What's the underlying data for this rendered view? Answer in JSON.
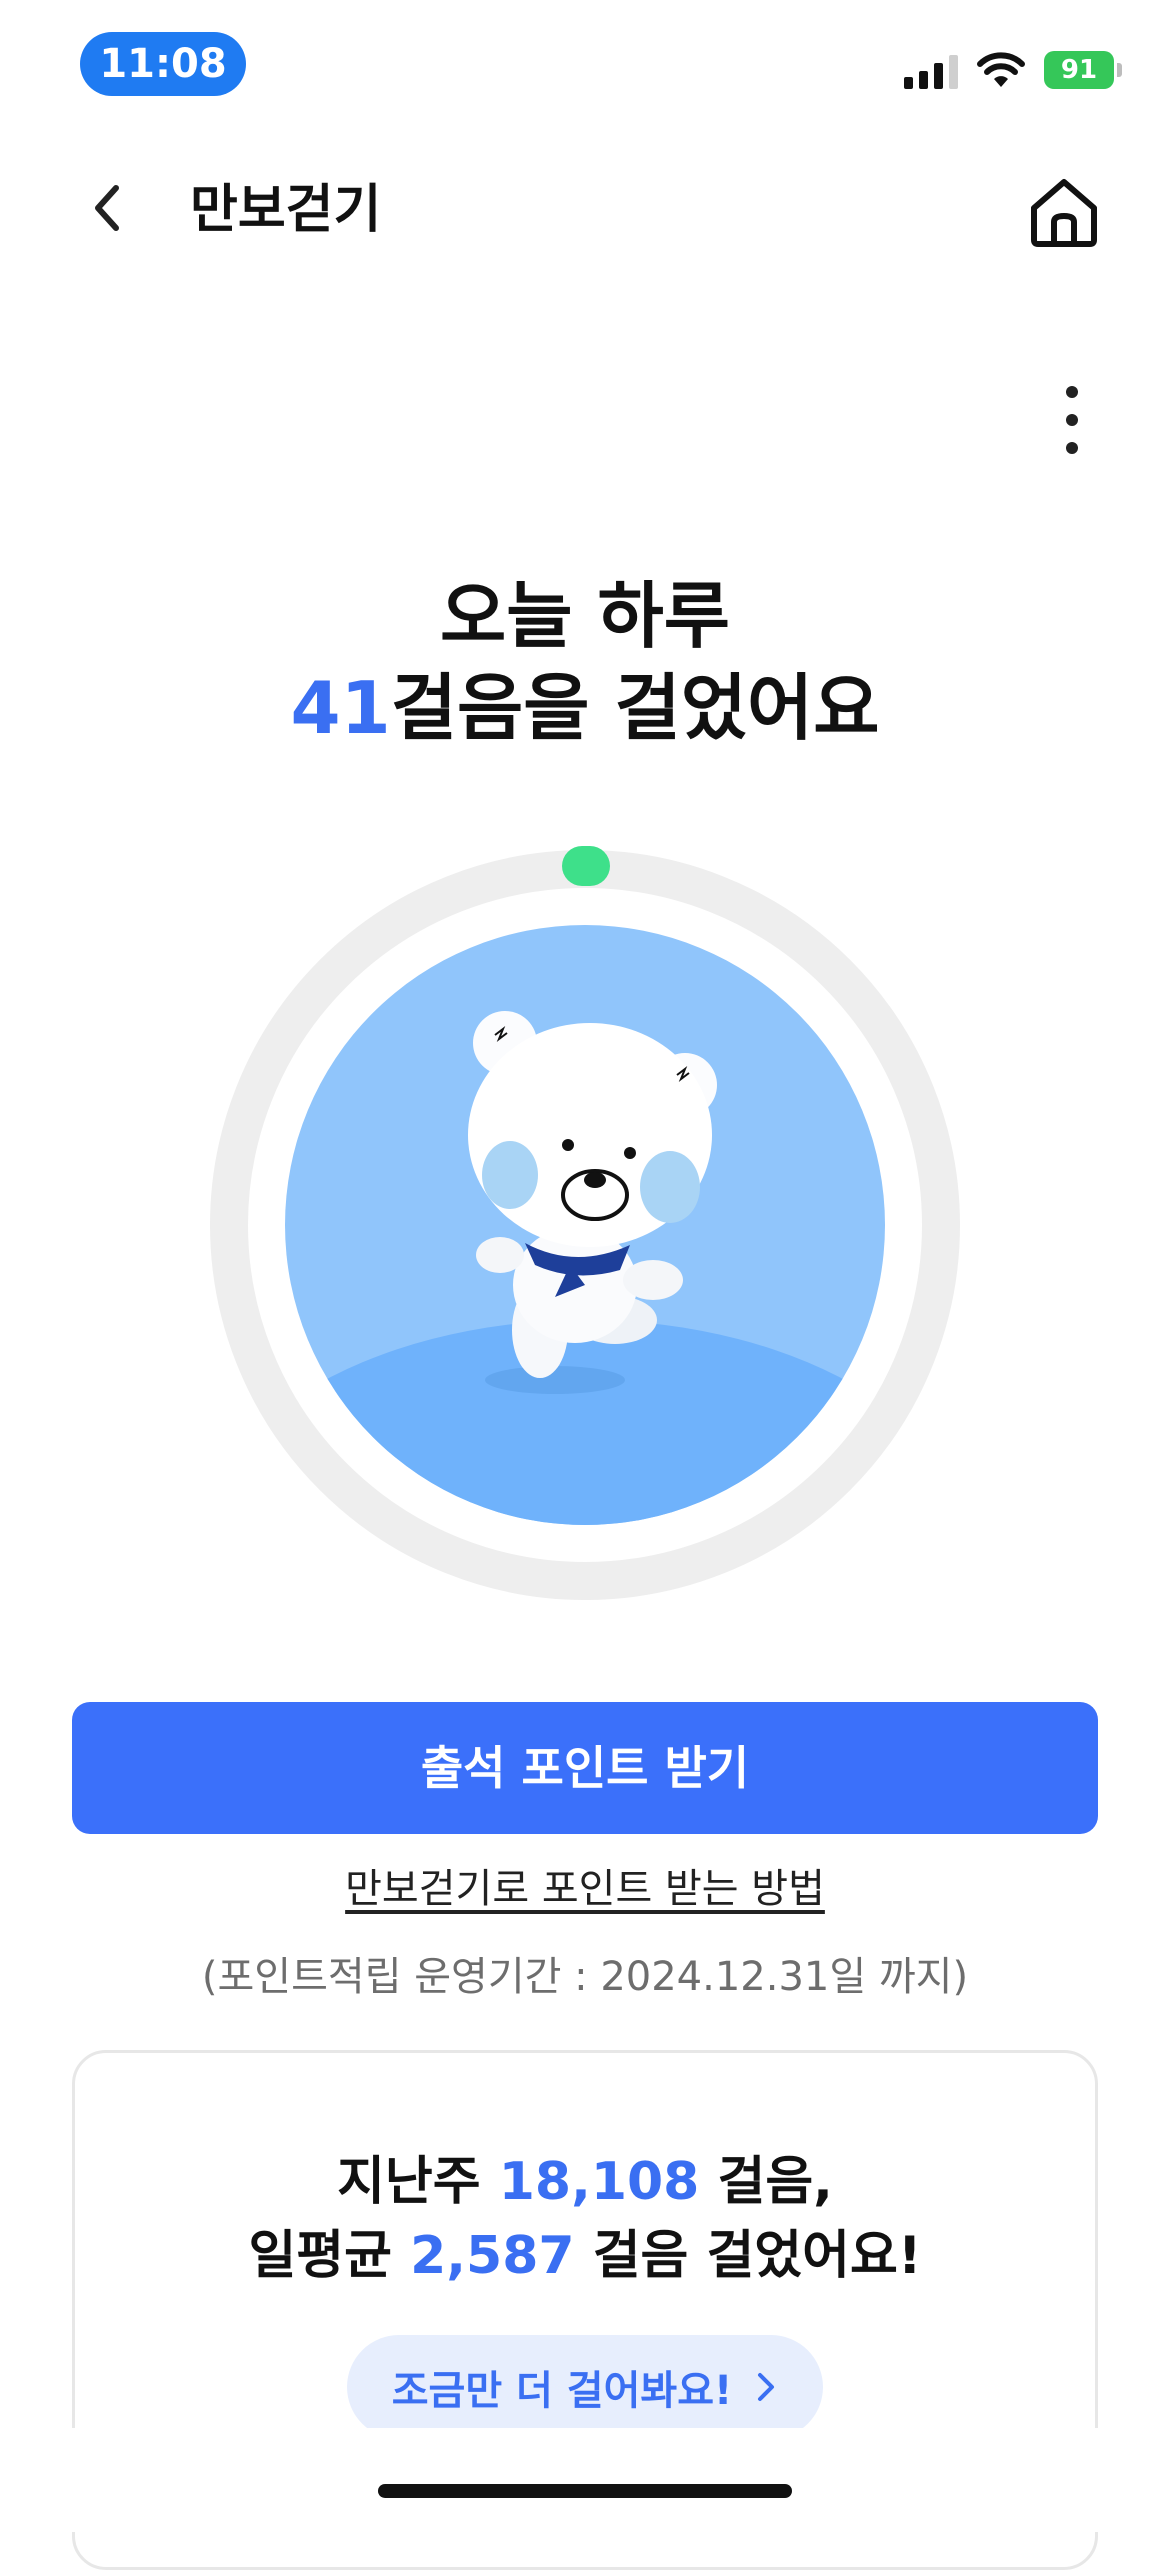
{
  "status_bar": {
    "time": "11:08",
    "battery": "91"
  },
  "nav": {
    "title": "만보걷기"
  },
  "headline": {
    "line1": "오늘 하루",
    "steps": "41",
    "line2_suffix": "걸음을 걸었어요"
  },
  "progress": {
    "steps_today": 41
  },
  "actions": {
    "attendance_button": "출석 포인트 받기",
    "howto_link": "만보걷기로 포인트 받는 방법",
    "period_note": "(포인트적립 운영기간 : 2024.12.31일 까지)"
  },
  "weekly_card": {
    "prefix1": "지난주",
    "last_week_steps": "18,108",
    "suffix1": "걸음,",
    "prefix2": "일평균",
    "daily_avg_steps": "2,587",
    "suffix2": "걸음 걸었어요!",
    "cta_label": "조금만 더 걸어봐요!"
  },
  "colors": {
    "accent": "#3b70fa",
    "highlight_blue": "#3a6ff2",
    "progress_dot": "#3ee08a",
    "circle_bg": "#90c5fb"
  },
  "icons": [
    "back-chevron-icon",
    "home-icon",
    "more-vertical-icon",
    "chevron-right-icon",
    "signal-icon",
    "wifi-icon",
    "battery-icon"
  ]
}
